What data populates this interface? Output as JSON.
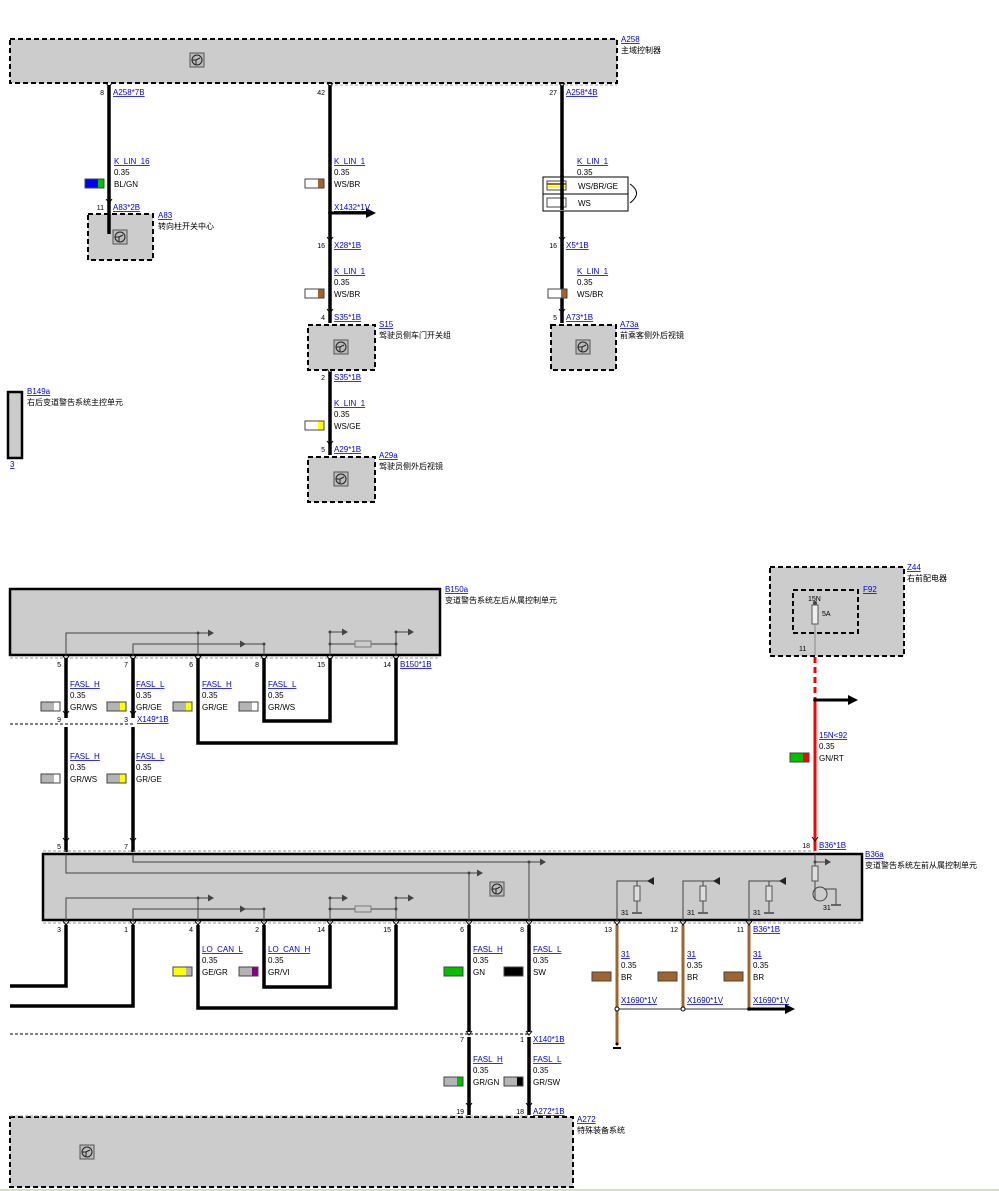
{
  "components": {
    "A258": {
      "id": "A258",
      "name": "主域控制器"
    },
    "A83": {
      "id": "A83",
      "name": "转向柱开关中心"
    },
    "S15": {
      "id": "S15",
      "name": "驾驶员侧车门开关组"
    },
    "A29a": {
      "id": "A29a",
      "name": "驾驶员侧外后视镜"
    },
    "A73a": {
      "id": "A73a",
      "name": "前乘客侧外后视镜"
    },
    "B149a": {
      "id": "B149a",
      "name": "右后变道警告系统主控单元",
      "partial_pin_label": "3"
    },
    "B150a": {
      "id": "B150a",
      "name": "变道警告系统左后从属控制单元"
    },
    "Z44": {
      "id": "Z44",
      "name": "右前配电器"
    },
    "F92": {
      "id": "F92",
      "terminal": "15N",
      "rating": "5A",
      "pin": "11"
    },
    "B36a": {
      "id": "B36a",
      "name": "变道警告系统左前从属控制单元"
    },
    "A272": {
      "id": "A272",
      "name": "特殊装备系统"
    }
  },
  "colors": {
    "WS": "#ffffff",
    "BR": "#a0652d",
    "GE": "#ffff00",
    "BL": "#0000ff",
    "GN": "#00c000",
    "GR": "#b4b4b4",
    "VI": "#800080",
    "SW": "#000000",
    "RT": "#ff0000",
    "component_fill": "#cccccc",
    "link": "#0000ee"
  },
  "wires": [
    {
      "signal": "K_LIN_16",
      "size": "0.35",
      "code": "BL/GN",
      "swatch": [
        "#0000ff",
        "#00c000"
      ]
    },
    {
      "signal": "K_LIN_1",
      "size": "0.35",
      "code": "WS/BR",
      "swatch": [
        "#ffffff",
        "#a0652d"
      ]
    },
    {
      "signal": "K_LIN_1",
      "size": "0.35",
      "alternatives": [
        {
          "code": "WS/BR/GE",
          "swatch": [
            "#ffffff",
            "#a0652d",
            "#ffff00"
          ]
        },
        {
          "code": "WS",
          "swatch": [
            "#ffffff"
          ]
        }
      ]
    },
    {
      "signal": "K_LIN_1",
      "size": "0.35",
      "code": "WS/BR",
      "swatch": [
        "#ffffff",
        "#a0652d"
      ]
    },
    {
      "signal": "K_LIN_1",
      "size": "0.35",
      "code": "WS/BR",
      "swatch": [
        "#ffffff",
        "#a0652d"
      ]
    },
    {
      "signal": "K_LIN_1",
      "size": "0.35",
      "code": "WS/GE",
      "swatch": [
        "#ffffff",
        "#ffff00"
      ]
    },
    {
      "signal": "FASL_H",
      "size": "0.35",
      "code": "GR/WS",
      "swatch": [
        "#b4b4b4",
        "#ffffff"
      ]
    },
    {
      "signal": "FASL_L",
      "size": "0.35",
      "code": "GR/GE",
      "swatch": [
        "#b4b4b4",
        "#ffff00"
      ]
    },
    {
      "signal": "FASL_H",
      "size": "0.35",
      "code": "GR/GE",
      "swatch": [
        "#b4b4b4",
        "#ffff00"
      ]
    },
    {
      "signal": "FASL_L",
      "size": "0.35",
      "code": "GR/WS",
      "swatch": [
        "#b4b4b4",
        "#ffffff"
      ]
    },
    {
      "signal": "FASL_H",
      "size": "0.35",
      "code": "GR/WS",
      "swatch": [
        "#b4b4b4",
        "#ffffff"
      ]
    },
    {
      "signal": "FASL_L",
      "size": "0.35",
      "code": "GR/GE",
      "swatch": [
        "#b4b4b4",
        "#ffff00"
      ]
    },
    {
      "signal": "15N<92",
      "size": "0.35",
      "code": "GN/RT",
      "swatch": [
        "#00c000",
        "#ff0000"
      ]
    },
    {
      "signal": "LO_CAN_L",
      "size": "0.35",
      "code": "GE/GR",
      "swatch": [
        "#ffff00",
        "#b4b4b4"
      ]
    },
    {
      "signal": "LO_CAN_H",
      "size": "0.35",
      "code": "GR/VI",
      "swatch": [
        "#b4b4b4",
        "#800080"
      ]
    },
    {
      "signal": "FASL_H",
      "size": "0.35",
      "code": "GN",
      "swatch": [
        "#00c000"
      ]
    },
    {
      "signal": "FASL_L",
      "size": "0.35",
      "code": "SW",
      "swatch": [
        "#000000"
      ]
    },
    {
      "signal": "31",
      "size": "0.35",
      "code": "BR",
      "swatch": [
        "#a0652d"
      ]
    },
    {
      "signal": "31",
      "size": "0.35",
      "code": "BR",
      "swatch": [
        "#a0652d"
      ]
    },
    {
      "signal": "31",
      "size": "0.35",
      "code": "BR",
      "swatch": [
        "#a0652d"
      ]
    },
    {
      "signal": "FASL_H",
      "size": "0.35",
      "code": "GR/GN",
      "swatch": [
        "#b4b4b4",
        "#00c000"
      ]
    },
    {
      "signal": "FASL_L",
      "size": "0.35",
      "code": "GR/SW",
      "swatch": [
        "#b4b4b4",
        "#000000"
      ]
    }
  ],
  "pins": [
    {
      "pin": "8",
      "connector": "A258*7B"
    },
    {
      "pin": "42"
    },
    {
      "pin": "27",
      "connector": "A258*4B"
    },
    {
      "pin": "11",
      "connector": "A83*2B"
    },
    {
      "pin": "16",
      "connector": "X28*1B"
    },
    {
      "pin": "16",
      "connector": "X5*1B"
    },
    {
      "pin": "4",
      "connector": "S35*1B"
    },
    {
      "pin": "5",
      "connector": "A73*1B"
    },
    {
      "pin": "2",
      "connector": "S35*1B"
    },
    {
      "pin": "5",
      "connector": "A29*1B"
    },
    {
      "pin": "5"
    },
    {
      "pin": "7"
    },
    {
      "pin": "6"
    },
    {
      "pin": "8"
    },
    {
      "pin": "15"
    },
    {
      "pin": "14",
      "connector": "B150*1B"
    },
    {
      "pin": "9"
    },
    {
      "pin": "3",
      "connector": "X149*1B"
    },
    {
      "pin": "5"
    },
    {
      "pin": "7"
    },
    {
      "pin": "18",
      "connector": "B36*1B"
    },
    {
      "pin": "3"
    },
    {
      "pin": "1"
    },
    {
      "pin": "4"
    },
    {
      "pin": "2"
    },
    {
      "pin": "14"
    },
    {
      "pin": "15"
    },
    {
      "pin": "6"
    },
    {
      "pin": "8"
    },
    {
      "pin": "13"
    },
    {
      "pin": "12"
    },
    {
      "pin": "11",
      "connector": "B36*1B"
    },
    {
      "pin": "7"
    },
    {
      "pin": "1",
      "connector": "X140*1B"
    },
    {
      "pin": "19"
    },
    {
      "pin": "18",
      "connector": "A272*1B"
    }
  ],
  "splices": [
    "X1432*1V",
    "X1690*1V",
    "X1690*1V",
    "X1690*1V"
  ],
  "ground_label": "31",
  "icons": {
    "control_unit": "control-unit-icon",
    "resistor": "resistor-icon",
    "transistor": "transistor-icon",
    "fuse": "fuse-icon",
    "ground": "ground-icon",
    "continuation": "arrow-right-icon"
  }
}
